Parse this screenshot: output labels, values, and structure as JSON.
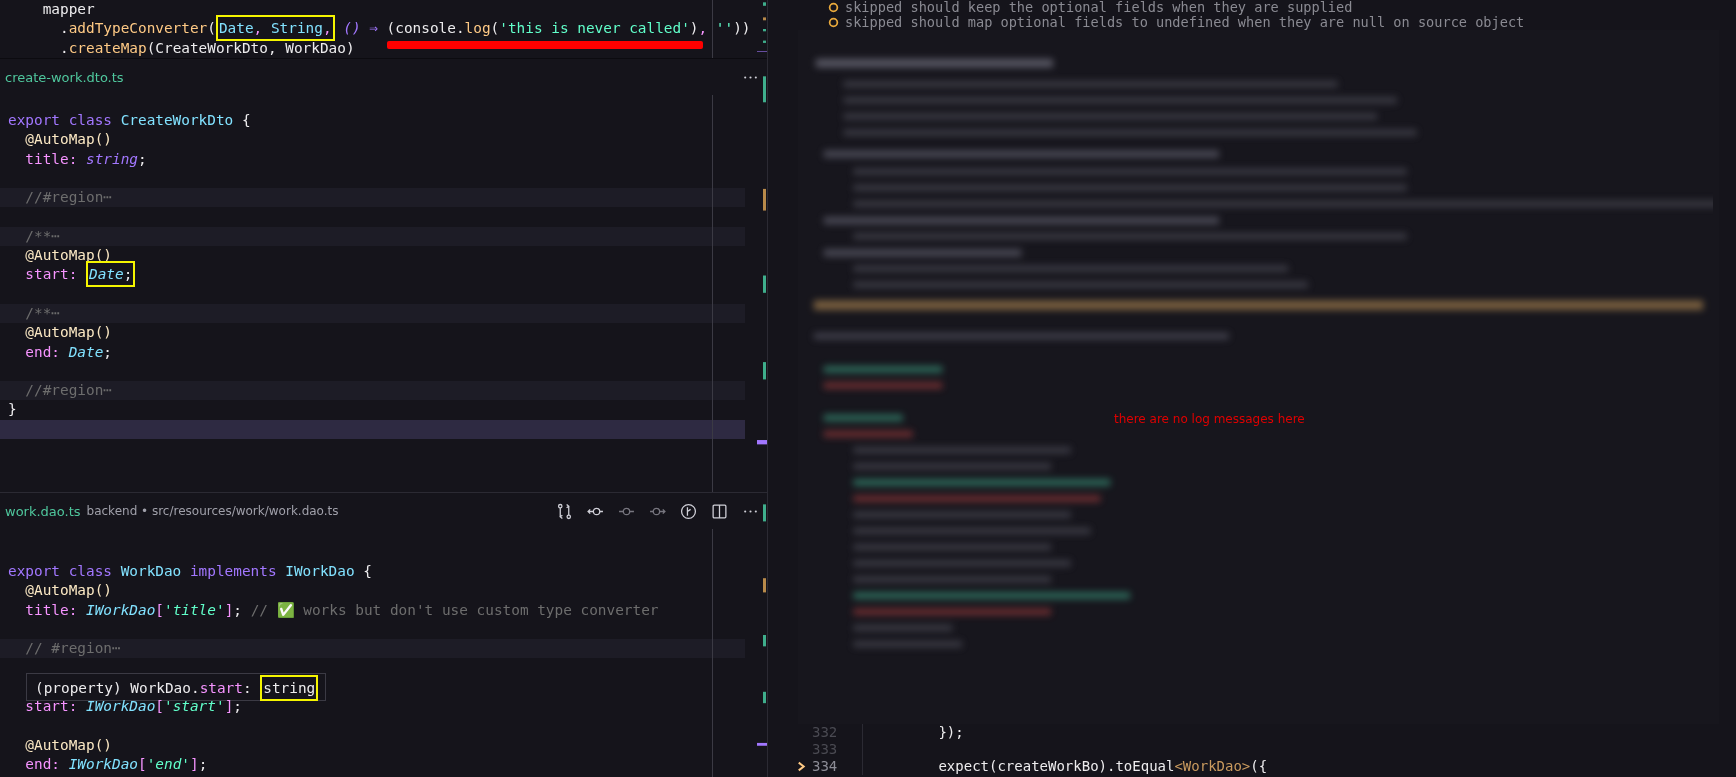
{
  "editors": [
    {
      "lines": [
        {
          "kind": "code",
          "tokens": [
            {
              "text": "    mapper",
              "kind": "plain"
            }
          ]
        },
        {
          "kind": "code",
          "tokens": [
            {
              "text": "      .",
              "kind": "plain"
            },
            {
              "text": "addTypeConverter",
              "kind": "fn"
            },
            {
              "text": "(",
              "kind": "plain"
            },
            {
              "kind": "box",
              "parts": [
                {
                  "text": "Date",
                  "kind": "cls"
                },
                {
                  "text": ", ",
                  "kind": "punct"
                },
                {
                  "text": "String",
                  "kind": "cls"
                },
                {
                  "text": ",",
                  "kind": "punct"
                }
              ]
            },
            {
              "text": " ()",
              "kind": "type"
            },
            {
              "text": " ⇒ ",
              "kind": "kw"
            },
            {
              "kind": "underline",
              "parts": [
                {
                  "text": "(console.",
                  "kind": "plain"
                },
                {
                  "text": "log",
                  "kind": "fn"
                },
                {
                  "text": "(",
                  "kind": "plain"
                },
                {
                  "text": "'this is never called'",
                  "kind": "str"
                },
                {
                  "text": ")",
                  "kind": "plain"
                },
                {
                  "text": ", ",
                  "kind": "punct"
                },
                {
                  "text": "''",
                  "kind": "str"
                },
                {
                  "text": "))",
                  "kind": "plain"
                }
              ]
            }
          ]
        },
        {
          "kind": "code",
          "tokens": [
            {
              "text": "      .",
              "kind": "plain"
            },
            {
              "text": "createMap",
              "kind": "fn"
            },
            {
              "text": "(CreateWorkDto, WorkDao)",
              "kind": "plain"
            }
          ]
        }
      ]
    },
    {
      "filename": "create-work.dto.ts",
      "lines": [
        {
          "kind": "code",
          "tokens": [
            {
              "text": "export class ",
              "kind": "kw"
            },
            {
              "text": "CreateWorkDto",
              "kind": "cls"
            },
            {
              "text": " {",
              "kind": "plain"
            }
          ]
        },
        {
          "kind": "code",
          "tokens": [
            {
              "text": "  @AutoMap()",
              "kind": "dec"
            }
          ]
        },
        {
          "kind": "code",
          "tokens": [
            {
              "text": "  title",
              "kind": "prop"
            },
            {
              "text": ": ",
              "kind": "punct"
            },
            {
              "text": "string",
              "kind": "type"
            },
            {
              "text": ";",
              "kind": "plain"
            }
          ]
        },
        {
          "kind": "blank"
        },
        {
          "kind": "folded",
          "tokens": [
            {
              "text": "  //#region",
              "kind": "cmt"
            },
            {
              "text": "⋯",
              "kind": "fold"
            }
          ]
        },
        {
          "kind": "blank"
        },
        {
          "kind": "folded",
          "tokens": [
            {
              "text": "  /**",
              "kind": "cmt"
            },
            {
              "text": "⋯",
              "kind": "fold"
            }
          ]
        },
        {
          "kind": "code",
          "tokens": [
            {
              "text": "  @AutoMap()",
              "kind": "dec"
            }
          ]
        },
        {
          "kind": "code",
          "tokens": [
            {
              "text": "  start",
              "kind": "prop"
            },
            {
              "text": ": ",
              "kind": "punct"
            },
            {
              "kind": "box",
              "parts": [
                {
                  "text": "Date",
                  "kind": "itcls"
                },
                {
                  "text": ";",
                  "kind": "plain"
                }
              ]
            }
          ]
        },
        {
          "kind": "blank"
        },
        {
          "kind": "folded",
          "tokens": [
            {
              "text": "  /**",
              "kind": "cmt"
            },
            {
              "text": "⋯",
              "kind": "fold"
            }
          ]
        },
        {
          "kind": "code",
          "tokens": [
            {
              "text": "  @AutoMap()",
              "kind": "dec"
            }
          ]
        },
        {
          "kind": "code",
          "tokens": [
            {
              "text": "  end",
              "kind": "prop"
            },
            {
              "text": ": ",
              "kind": "punct"
            },
            {
              "text": "Date",
              "kind": "itcls"
            },
            {
              "text": ";",
              "kind": "plain"
            }
          ]
        },
        {
          "kind": "blank"
        },
        {
          "kind": "folded",
          "tokens": [
            {
              "text": "  //#region",
              "kind": "cmt"
            },
            {
              "text": "⋯",
              "kind": "fold"
            }
          ]
        },
        {
          "kind": "code",
          "tokens": [
            {
              "text": "}",
              "kind": "plain"
            }
          ]
        },
        {
          "kind": "current"
        }
      ]
    },
    {
      "filename": "work.dao.ts",
      "path": "backend • src/resources/work/work.dao.ts",
      "lines": [
        {
          "kind": "code",
          "tokens": [
            {
              "text": "export class ",
              "kind": "kw"
            },
            {
              "text": "WorkDao",
              "kind": "cls"
            },
            {
              "text": " implements ",
              "kind": "kw"
            },
            {
              "text": "IWorkDao",
              "kind": "cls"
            },
            {
              "text": " {",
              "kind": "plain"
            }
          ]
        },
        {
          "kind": "code",
          "tokens": [
            {
              "text": "  @AutoMap()",
              "kind": "dec"
            }
          ]
        },
        {
          "kind": "code",
          "tokens": [
            {
              "text": "  title",
              "kind": "prop"
            },
            {
              "text": ": ",
              "kind": "punct"
            },
            {
              "text": "IWorkDao",
              "kind": "itcls"
            },
            {
              "text": "[",
              "kind": "punct"
            },
            {
              "text": "'title'",
              "kind": "itstr"
            },
            {
              "text": "]",
              "kind": "punct"
            },
            {
              "text": "; ",
              "kind": "plain"
            },
            {
              "text": "// ✅ works but don't use custom type converter",
              "kind": "cmt"
            }
          ]
        },
        {
          "kind": "blank"
        },
        {
          "kind": "folded",
          "tokens": [
            {
              "text": "  // #region",
              "kind": "cmt"
            },
            {
              "text": "⋯",
              "kind": "fold"
            }
          ]
        },
        {
          "kind": "blank"
        },
        {
          "kind": "hover",
          "tokens": [
            {
              "text": "(property) WorkDao.",
              "kind": "plain"
            },
            {
              "text": "start",
              "kind": "prop"
            },
            {
              "text": ": ",
              "kind": "plain"
            },
            {
              "kind": "box",
              "parts": [
                {
                  "text": "string",
                  "kind": "plain"
                }
              ]
            }
          ]
        },
        {
          "kind": "code",
          "tokens": [
            {
              "text": "  start",
              "kind": "prop"
            },
            {
              "text": ": ",
              "kind": "punct"
            },
            {
              "text": "IWorkDao",
              "kind": "itcls"
            },
            {
              "text": "[",
              "kind": "punct"
            },
            {
              "text": "'start'",
              "kind": "itstr"
            },
            {
              "text": "]",
              "kind": "punct"
            },
            {
              "text": ";",
              "kind": "plain"
            }
          ]
        },
        {
          "kind": "blank"
        },
        {
          "kind": "code",
          "tokens": [
            {
              "text": "  @AutoMap()",
              "kind": "dec"
            }
          ]
        },
        {
          "kind": "code",
          "tokens": [
            {
              "text": "  end",
              "kind": "prop"
            },
            {
              "text": ": ",
              "kind": "punct"
            },
            {
              "text": "IWorkDao",
              "kind": "itcls"
            },
            {
              "text": "[",
              "kind": "punct"
            },
            {
              "text": "'end'",
              "kind": "itstr"
            },
            {
              "text": "]",
              "kind": "punct"
            },
            {
              "text": ";",
              "kind": "plain"
            }
          ]
        }
      ]
    }
  ],
  "test_output": {
    "lines": [
      {
        "text": "skipped should keep the optional fields when they are supplied"
      },
      {
        "text": "skipped should map optional fields to undefined when they are null on source object"
      }
    ],
    "overlay_message": "there are no log messages here"
  },
  "code": {
    "lines": [
      {
        "number": "332",
        "active": false,
        "tokens": [
          {
            "text": "        });",
            "kind": "plain"
          }
        ]
      },
      {
        "number": "333",
        "active": false
      },
      {
        "number": "334",
        "active": true,
        "tokens": [
          {
            "text": "        expect(createWorkBo).toEqual",
            "kind": "plain"
          },
          {
            "text": "<WorkDao>",
            "kind": "generic"
          },
          {
            "text": "({",
            "kind": "plain"
          }
        ]
      }
    ]
  }
}
